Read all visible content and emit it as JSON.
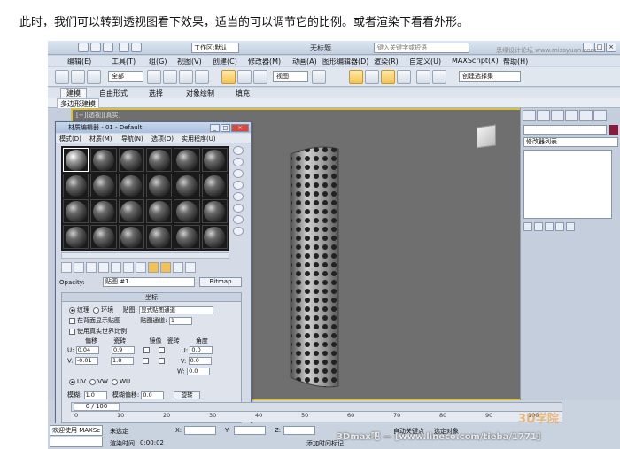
{
  "caption": "此时，我们可以转到透视图看下效果，适当的可以调节它的比例。或者渲染下看看外形。",
  "app": {
    "workspace": "工作区:默认",
    "title": "无标题",
    "search_placeholder": "键入关键字或短语",
    "menu": [
      "编辑(E)",
      "工具(T)",
      "组(G)",
      "视图(V)",
      "创建(C)",
      "修改器(M)",
      "动画(A)",
      "图形编辑器(D)",
      "渲染(R)",
      "自定义(U)",
      "MAXScript(X)",
      "帮助(H)"
    ],
    "toolbar": {
      "filter": "全部",
      "view": "视图",
      "selection_set": "创建选择集"
    },
    "ribbon_tabs": [
      "建模",
      "自由形式",
      "选择",
      "对象绘制",
      "填充"
    ],
    "ribbon_sub": "多边形建模",
    "viewport_label": "[+][透视][真实]",
    "cmd_panel": {
      "modifier_list": "修改器列表"
    }
  },
  "material_editor": {
    "title": "材质编辑器 - 01 - Default",
    "menu": [
      "模式(D)",
      "材质(M)",
      "导航(N)",
      "选项(O)",
      "实用程序(U)"
    ],
    "opacity_label": "Opacity:",
    "map_name": "贴图 #1",
    "map_type": "Bitmap",
    "rollout_title": "坐标",
    "texture_label": "纹理",
    "environ_label": "环境",
    "mapping_label": "贴图:",
    "mapping_value": "显式贴图通道",
    "show_back": "在背面显示贴图",
    "real_world": "使用真实世界比例",
    "map_channel_label": "贴图通道:",
    "map_channel": "1",
    "col_offset": "偏移",
    "col_tiling": "瓷砖",
    "col_mirror": "镜像",
    "col_tile": "瓷砖",
    "col_angle": "角度",
    "u_offset": "0.04",
    "v_offset": "-0.01",
    "u_tiling": "0.9",
    "v_tiling": "1.8",
    "u_angle": "0.0",
    "v_angle": "0.0",
    "w_angle": "0.0",
    "uv_label": "UV",
    "vw_label": "VW",
    "wu_label": "WU",
    "blur_label": "模糊:",
    "blur_value": "1.0",
    "blur_offset_label": "模糊偏移:",
    "blur_offset_value": "0.0",
    "rotate_button": "旋转"
  },
  "timeline": {
    "position": "0 / 100",
    "ticks": [
      "0",
      "10",
      "20",
      "30",
      "40",
      "50",
      "60",
      "70",
      "80",
      "90",
      "100"
    ]
  },
  "status": {
    "welcome": "欢迎使用 MAXSc",
    "render_time_label": "渲染时间",
    "render_time": "0:00:02",
    "unselected": "未选定",
    "x_label": "X:",
    "y_label": "Y:",
    "z_label": "Z:",
    "add_marker": "添加时间标记",
    "auto_key": "自动关键点",
    "selected": "选定对象"
  },
  "overlay": {
    "watermark": "3Dmax吧 — [www.lineco.com/tieba/1771]",
    "logo": "3D学院",
    "site": "思缘设计论坛 www.missyuan.com"
  }
}
